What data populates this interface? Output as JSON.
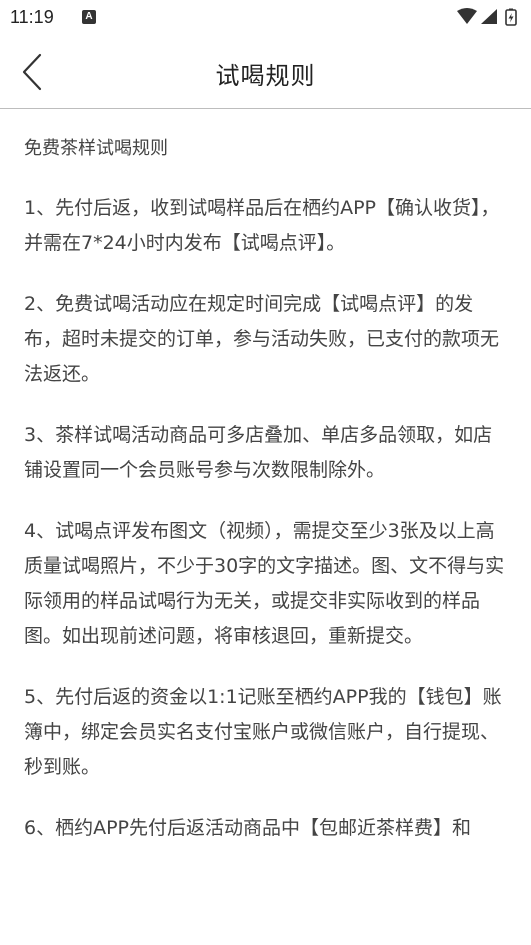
{
  "status_bar": {
    "time": "11:19",
    "notification_letter": "A",
    "icons": [
      "wifi-icon",
      "cell-signal-icon",
      "battery-icon"
    ]
  },
  "nav": {
    "back_icon": "chevron-left-icon",
    "title": "试喝规则"
  },
  "content": {
    "heading": "免费茶样试喝规则",
    "rules": [
      "1、先付后返，收到试喝样品后在栖约APP【确认收货】，并需在7*24小时内发布【试喝点评】。",
      "2、免费试喝活动应在规定时间完成【试喝点评】的发布，超时未提交的订单，参与活动失败，已支付的款项无法返还。",
      "3、茶样试喝活动商品可多店叠加、单店多品领取，如店铺设置同一个会员账号参与次数限制除外。",
      "4、试喝点评发布图文（视频），需提交至少3张及以上高质量试喝照片，不少于30字的文字描述。图、文不得与实际领用的样品试喝行为无关，或提交非实际收到的样品图。如出现前述问题，将审核退回，重新提交。",
      "5、先付后返的资金以1:1记账至栖约APP我的【钱包】账簿中，绑定会员实名支付宝账户或微信账户，自行提现、秒到账。",
      "6、栖约APP先付后返活动商品中【包邮近茶样费】和"
    ]
  },
  "colors": {
    "background": "#ffffff",
    "text": "#444444",
    "divider": "#bdbdbd"
  }
}
